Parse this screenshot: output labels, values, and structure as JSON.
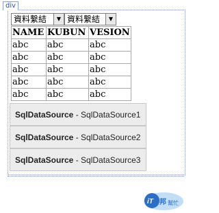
{
  "designer": {
    "div_tag_label": "div"
  },
  "dropdowns": [
    {
      "value": "資料繫結"
    },
    {
      "value": "資料繫結"
    }
  ],
  "grid": {
    "columns": [
      "NAME",
      "KUBUN",
      "VESION"
    ],
    "rows": [
      [
        "abc",
        "abc",
        "abc"
      ],
      [
        "abc",
        "abc",
        "abc"
      ],
      [
        "abc",
        "abc",
        "abc"
      ],
      [
        "abc",
        "abc",
        "abc"
      ],
      [
        "abc",
        "abc",
        "abc"
      ]
    ]
  },
  "data_sources": [
    {
      "type": "SqlDataSource",
      "separator": " - ",
      "id": "SqlDataSource1"
    },
    {
      "type": "SqlDataSource",
      "separator": " - ",
      "id": "SqlDataSource2"
    },
    {
      "type": "SqlDataSource",
      "separator": " - ",
      "id": "SqlDataSource3"
    }
  ],
  "watermark": {
    "logo_text": "iT邦幫忙",
    "colors": {
      "blue": "#2b6fc7",
      "light": "#8fc1ef"
    }
  }
}
